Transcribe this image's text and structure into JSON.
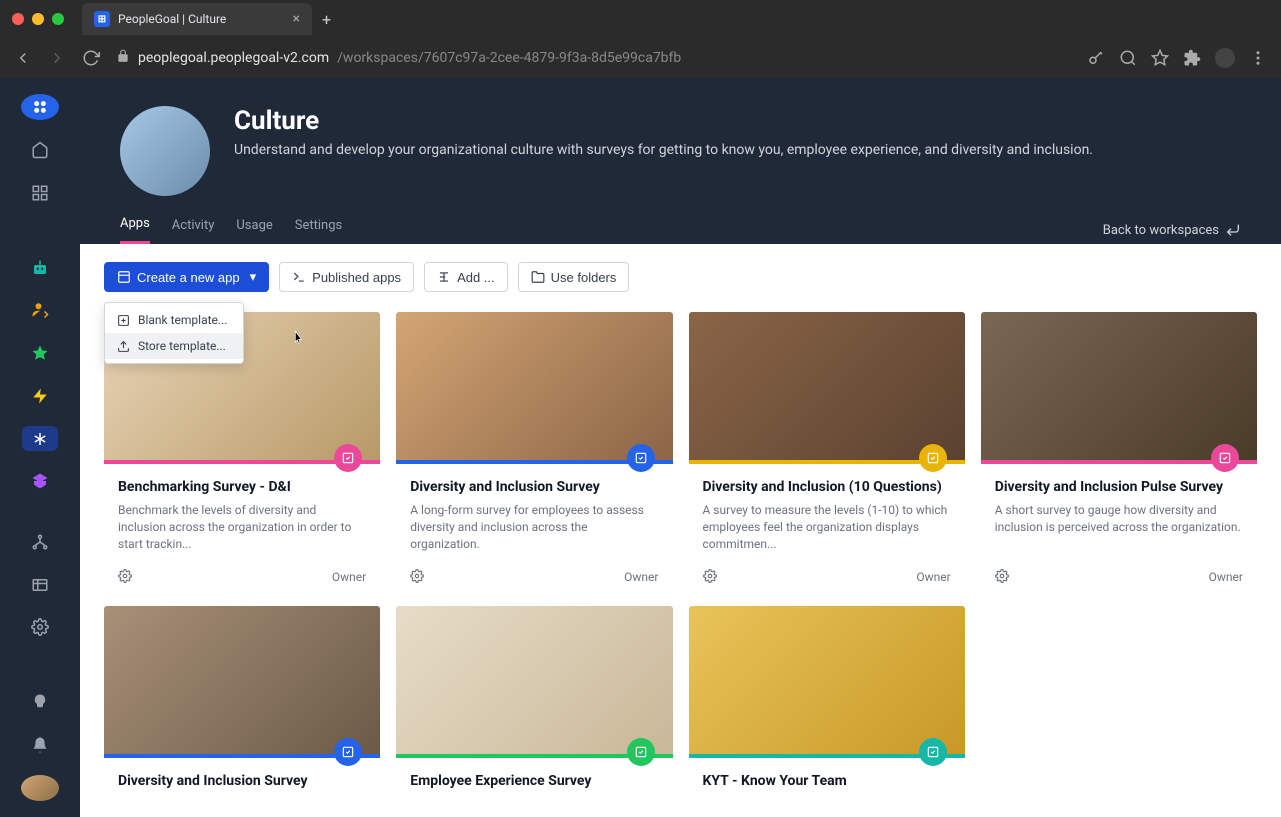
{
  "browser": {
    "tab_title": "PeopleGoal | Culture",
    "url_domain": "peoplegoal.peoplegoal-v2.com",
    "url_path": "/workspaces/7607c97a-2cee-4879-9f3a-8d5e99ca7bfb"
  },
  "header": {
    "title": "Culture",
    "description": "Understand and develop your organizational culture with surveys for getting to know you, employee experience, and diversity and inclusion."
  },
  "tabs": {
    "apps": "Apps",
    "activity": "Activity",
    "usage": "Usage",
    "settings": "Settings",
    "back": "Back to workspaces"
  },
  "toolbar": {
    "create": "Create a new app",
    "published": "Published apps",
    "add": "Add ...",
    "folders": "Use folders"
  },
  "dropdown": {
    "blank": "Blank template...",
    "store": "Store template..."
  },
  "cards": [
    {
      "title": "Benchmarking Survey - D&I",
      "desc": "Benchmark the levels of diversity and inclusion across the organization in order to start trackin...",
      "role": "Owner",
      "stripe": "#ec4899",
      "badge_bg": "#ec4899",
      "img_class": "img-office"
    },
    {
      "title": "Diversity and Inclusion Survey",
      "desc": "A long-form survey for employees to assess diversity and inclusion across the organization.",
      "role": "Owner",
      "stripe": "#2563eb",
      "badge_bg": "#2563eb",
      "img_class": "img-group1"
    },
    {
      "title": "Diversity and Inclusion (10 Questions)",
      "desc": "A survey to measure the levels (1-10) to which employees feel the organization displays commitmen...",
      "role": "Owner",
      "stripe": "#eab308",
      "badge_bg": "#eab308",
      "img_class": "img-cafe"
    },
    {
      "title": "Diversity and Inclusion Pulse Survey",
      "desc": "A short survey to gauge how diversity and inclusion is perceived across the organization.",
      "role": "Owner",
      "stripe": "#ec4899",
      "badge_bg": "#ec4899",
      "img_class": "img-meeting"
    },
    {
      "title": "Diversity and Inclusion Survey",
      "desc": "",
      "role": "",
      "stripe": "#2563eb",
      "badge_bg": "#2563eb",
      "img_class": "img-group2"
    },
    {
      "title": "Employee Experience Survey",
      "desc": "",
      "role": "",
      "stripe": "#22c55e",
      "badge_bg": "#22c55e",
      "img_class": "img-laugh"
    },
    {
      "title": "KYT - Know Your Team",
      "desc": "",
      "role": "",
      "stripe": "#14b8a6",
      "badge_bg": "#14b8a6",
      "img_class": "img-yellow"
    }
  ]
}
